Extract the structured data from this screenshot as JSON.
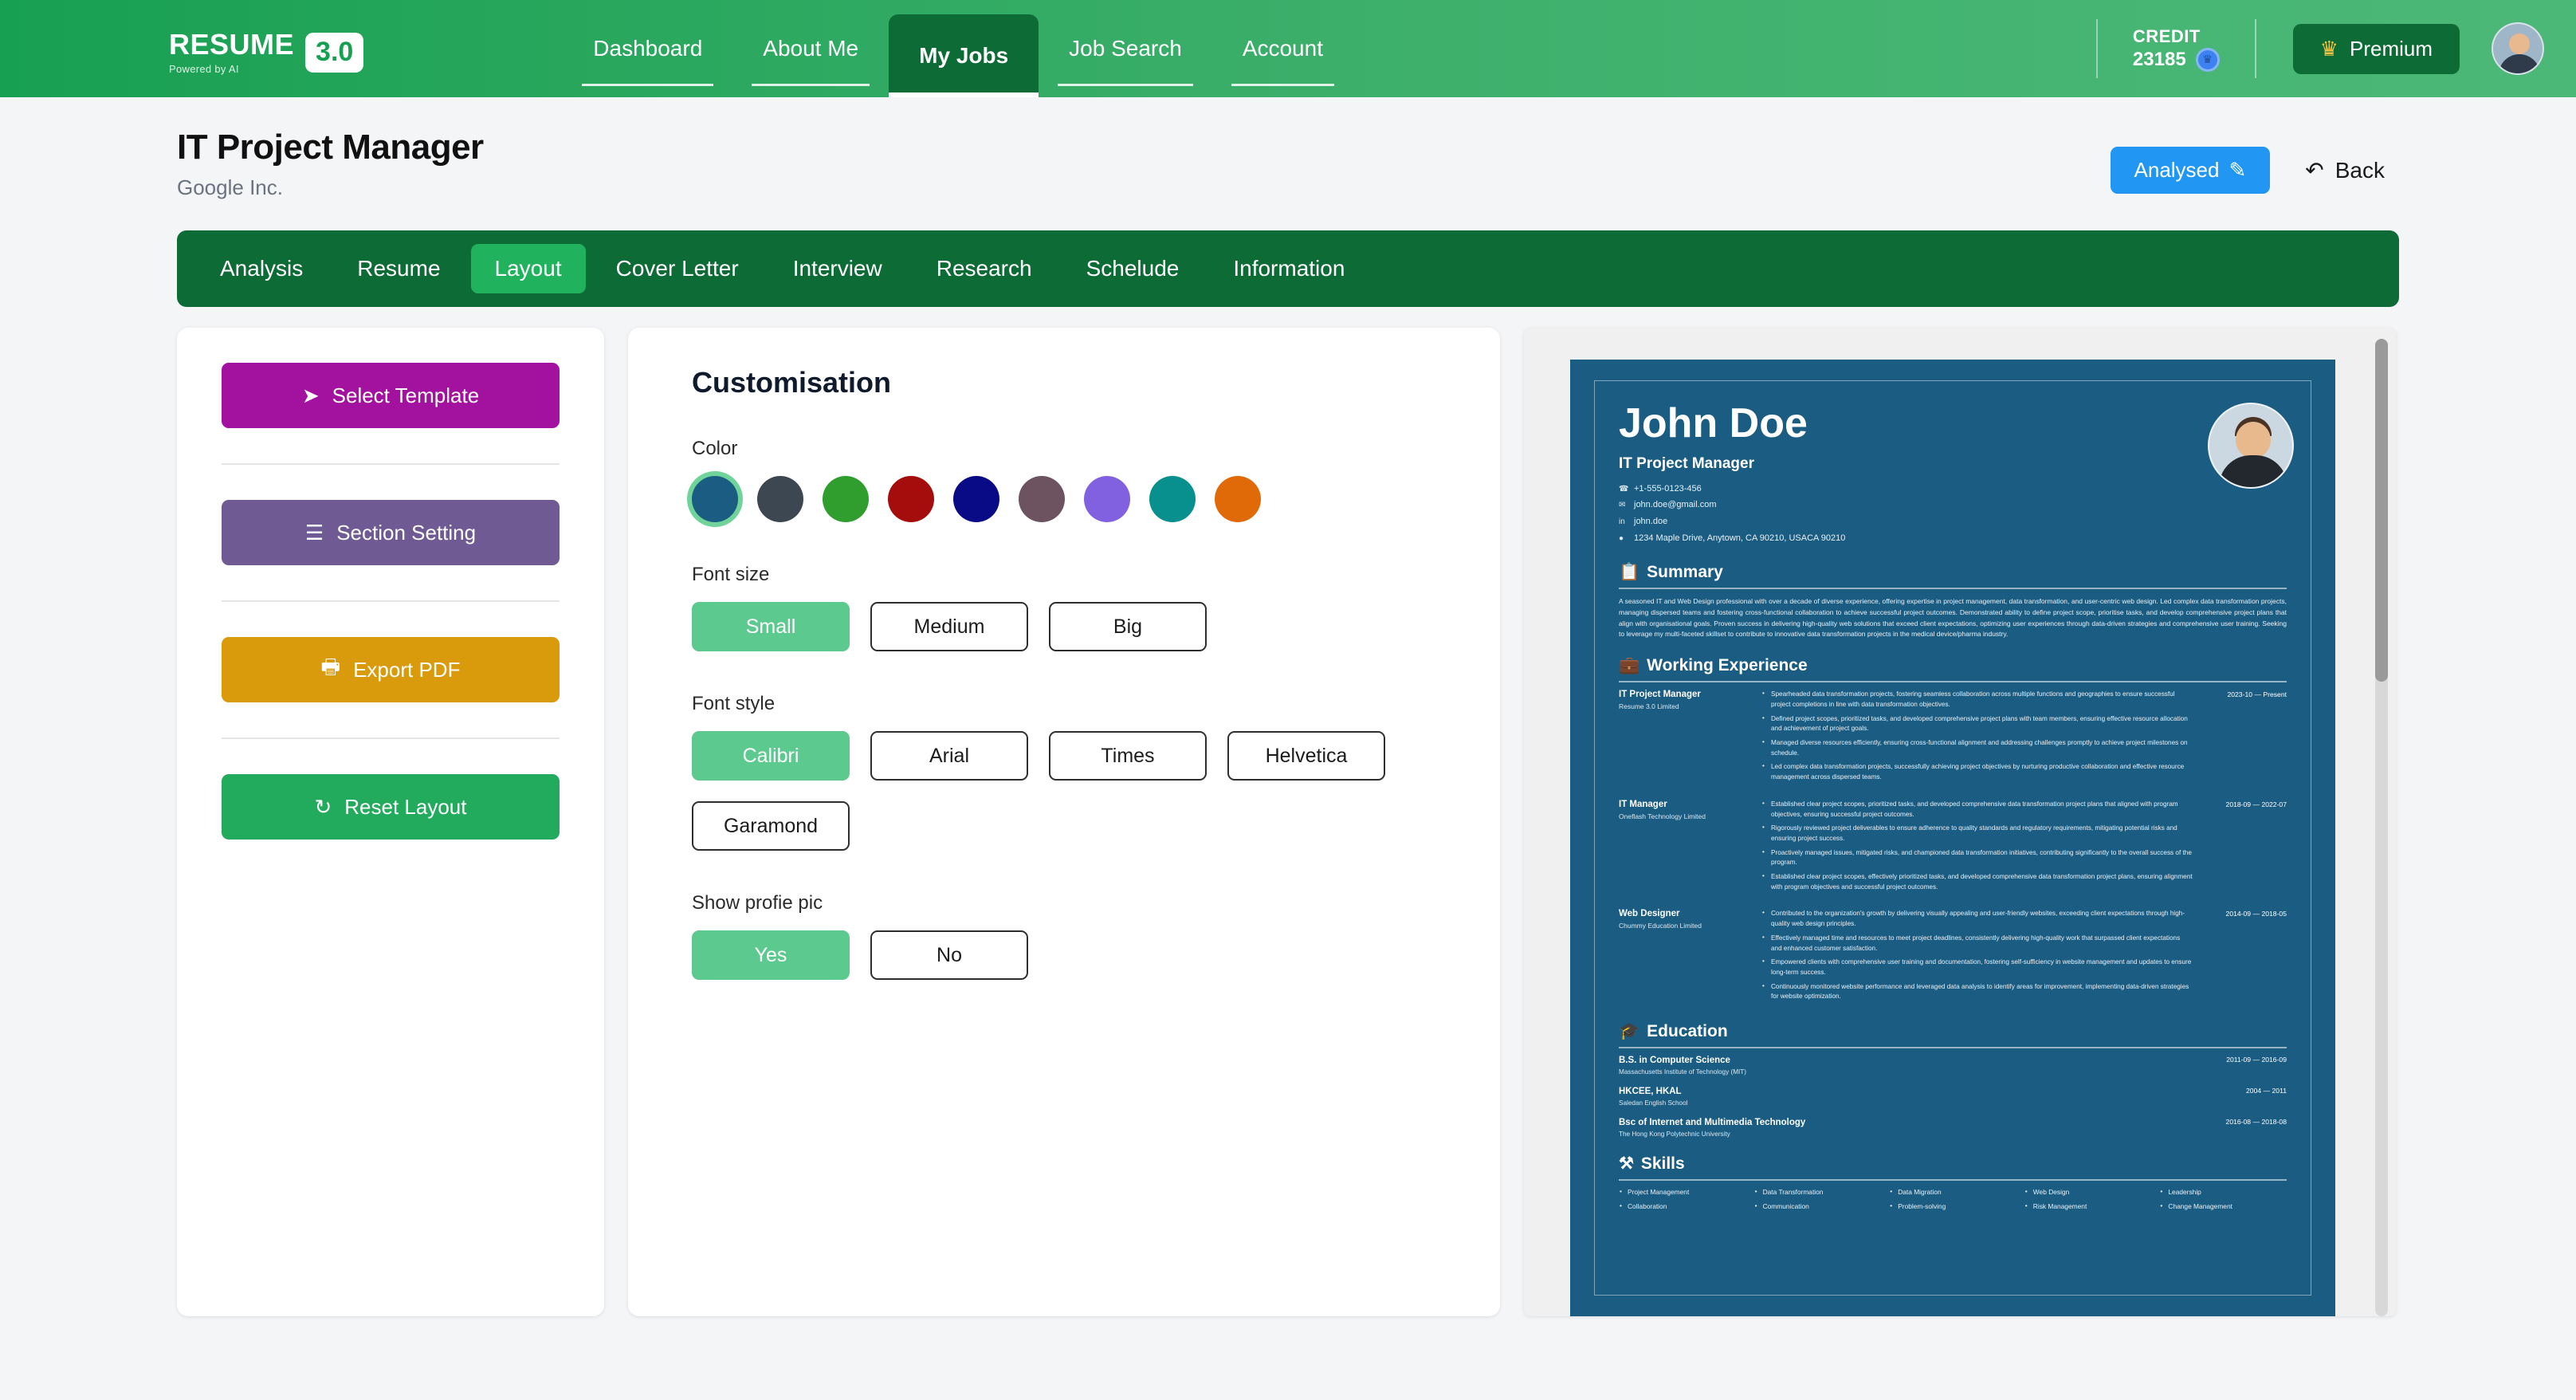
{
  "navbar": {
    "brand_word": "RESUME",
    "brand_badge": "3.0",
    "brand_sub": "Powered by AI",
    "links": [
      {
        "label": "Dashboard",
        "active": false
      },
      {
        "label": "About Me",
        "active": false
      },
      {
        "label": "My Jobs",
        "active": true
      },
      {
        "label": "Job Search",
        "active": false
      },
      {
        "label": "Account",
        "active": false
      }
    ],
    "credit_label": "CREDIT",
    "credit_value": "23185",
    "coin_icon": "crown-icon",
    "premium_label": "Premium",
    "premium_icon": "crown-icon",
    "avatar_name": "user-avatar"
  },
  "page_header": {
    "job_title": "IT Project Manager",
    "company": "Google Inc.",
    "analysed_label": "Analysed",
    "analysed_icon": "pencil-icon",
    "back_label": "Back",
    "back_icon": "undo-arrow-icon",
    "accent_blue": "#2196f3"
  },
  "tabs": [
    {
      "label": "Analysis",
      "active": false
    },
    {
      "label": "Resume",
      "active": false
    },
    {
      "label": "Layout",
      "active": true
    },
    {
      "label": "Cover Letter",
      "active": false
    },
    {
      "label": "Interview",
      "active": false
    },
    {
      "label": "Research",
      "active": false
    },
    {
      "label": "Schelude",
      "active": false
    },
    {
      "label": "Information",
      "active": false
    }
  ],
  "sidebar": {
    "buttons": [
      {
        "label": "Select Template",
        "icon": "cursor-arrow-icon",
        "color": "#a2129e"
      },
      {
        "label": "Section Setting",
        "icon": "sliders-icon",
        "color": "#6f5a93"
      },
      {
        "label": "Export PDF",
        "icon": "printer-icon",
        "color": "#d99a0b"
      },
      {
        "label": "Reset Layout",
        "icon": "reset-icon",
        "color": "#22ab5c"
      }
    ]
  },
  "customisation": {
    "title": "Customisation",
    "color_label": "Color",
    "colors": [
      {
        "hex": "#1b5c82",
        "selected": true
      },
      {
        "hex": "#3c4752",
        "selected": false
      },
      {
        "hex": "#2f9e2f",
        "selected": false
      },
      {
        "hex": "#a50d0d",
        "selected": false
      },
      {
        "hex": "#090b86",
        "selected": false
      },
      {
        "hex": "#6d5260",
        "selected": false
      },
      {
        "hex": "#8161e0",
        "selected": false
      },
      {
        "hex": "#07908d",
        "selected": false
      },
      {
        "hex": "#df6a07",
        "selected": false
      }
    ],
    "font_size_label": "Font size",
    "font_sizes": [
      {
        "label": "Small",
        "selected": true
      },
      {
        "label": "Medium",
        "selected": false
      },
      {
        "label": "Big",
        "selected": false
      }
    ],
    "font_style_label": "Font style",
    "font_styles": [
      {
        "label": "Calibri",
        "selected": true
      },
      {
        "label": "Arial",
        "selected": false
      },
      {
        "label": "Times",
        "selected": false
      },
      {
        "label": "Helvetica",
        "selected": false
      },
      {
        "label": "Garamond",
        "selected": false
      }
    ],
    "profile_pic_label": "Show profie pic",
    "profile_pic_options": [
      {
        "label": "Yes",
        "selected": true
      },
      {
        "label": "No",
        "selected": false
      }
    ]
  },
  "resume": {
    "accent": "#1b5c82",
    "name": "John Doe",
    "role": "IT Project Manager",
    "contacts": [
      {
        "icon": "phone-icon",
        "text": "+1-555-0123-456"
      },
      {
        "icon": "email-icon",
        "text": "john.doe@gmail.com"
      },
      {
        "icon": "linkedin-icon",
        "text": "john.doe"
      },
      {
        "icon": "location-icon",
        "text": "1234 Maple Drive, Anytown, CA 90210, USACA 90210"
      }
    ],
    "summary": {
      "heading": "Summary",
      "icon": "clipboard-icon",
      "text": "A seasoned IT and Web Design professional with over a decade of diverse experience, offering expertise in project management, data transformation, and user-centric web design. Led complex data transformation projects, managing dispersed teams and fostering cross-functional collaboration to achieve successful project outcomes. Demonstrated ability to define project scope, prioritise tasks, and develop comprehensive project plans that align with organisational goals. Proven success in delivering high-quality web solutions that exceed client expectations, optimizing user experiences through data-driven strategies and comprehensive user training. Seeking to leverage my multi-faceted skillset to contribute to innovative data transformation projects in the medical device/pharma industry."
    },
    "experience": {
      "heading": "Working Experience",
      "icon": "briefcase-icon",
      "items": [
        {
          "title": "IT Project Manager",
          "org": "Resume 3.0 Limited",
          "date": "2023-10 — Present",
          "bullets": [
            "Spearheaded data transformation projects, fostering seamless collaboration across multiple functions and geographies to ensure successful project completions in line with data transformation objectives.",
            "Defined project scopes, prioritized tasks, and developed comprehensive project plans with team members, ensuring effective resource allocation and achievement of project goals.",
            "Managed diverse resources efficiently, ensuring cross-functional alignment and addressing challenges promptly to achieve project milestones on schedule.",
            "Led complex data transformation projects, successfully achieving project objectives by nurturing productive collaboration and effective resource management across dispersed teams."
          ]
        },
        {
          "title": "IT Manager",
          "org": "Oneflash Technology Limited",
          "date": "2018-09 — 2022-07",
          "bullets": [
            "Established clear project scopes, prioritized tasks, and developed comprehensive data transformation project plans that aligned with program objectives, ensuring successful project outcomes.",
            "Rigorously reviewed project deliverables to ensure adherence to quality standards and regulatory requirements, mitigating potential risks and ensuring project success.",
            "Proactively managed issues, mitigated risks, and championed data transformation initiatives, contributing significantly to the overall success of the program.",
            "Established clear project scopes, effectively prioritized tasks, and developed comprehensive data transformation project plans, ensuring alignment with program objectives and successful project outcomes."
          ]
        },
        {
          "title": "Web Designer",
          "org": "Chummy Education Limited",
          "date": "2014-09 — 2018-05",
          "bullets": [
            "Contributed to the organization's growth by delivering visually appealing and user-friendly websites, exceeding client expectations through high-quality web design principles.",
            "Effectively managed time and resources to meet project deadlines, consistently delivering high-quality work that surpassed client expectations and enhanced customer satisfaction.",
            "Empowered clients with comprehensive user training and documentation, fostering self-sufficiency in website management and updates to ensure long-term success.",
            "Continuously monitored website performance and leveraged data analysis to identify areas for improvement, implementing data-driven strategies for website optimization."
          ]
        }
      ]
    },
    "education": {
      "heading": "Education",
      "icon": "graduation-cap-icon",
      "items": [
        {
          "degree": "B.S. in Computer Science",
          "school": "Massachusetts Institute of Technology (MIT)",
          "date": "2011-09 — 2016-09"
        },
        {
          "degree": "HKCEE, HKAL",
          "school": "Saledan English School",
          "date": "2004 — 2011"
        },
        {
          "degree": "Bsc of Internet and Multimedia Technology",
          "school": "The Hong Kong Polytechnic University",
          "date": "2016-08 — 2018-08"
        }
      ]
    },
    "skills": {
      "heading": "Skills",
      "icon": "tools-icon",
      "items": [
        "Project Management",
        "Data Transformation",
        "Data Migration",
        "Web Design",
        "Leadership",
        "Collaboration",
        "Communication",
        "Problem-solving",
        "Risk Management",
        "Change Management"
      ]
    }
  }
}
